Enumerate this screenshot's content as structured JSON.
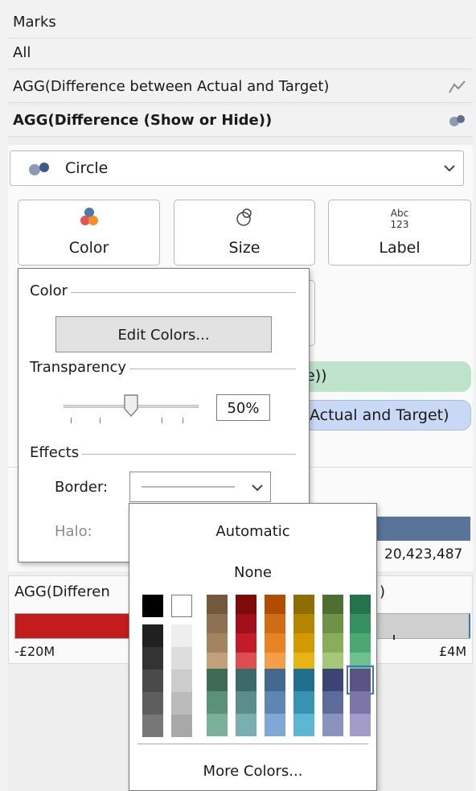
{
  "marks": {
    "header": "Marks",
    "rows": [
      {
        "label": "All"
      },
      {
        "label": "AGG(Difference between Actual and Target)"
      },
      {
        "label": "AGG(Difference (Show or Hide))"
      }
    ],
    "mark_type": "Circle",
    "cards": [
      "Color",
      "Size",
      "Label"
    ],
    "card_icons": [
      "color-dots-icon",
      "size-circles-icon",
      "abc-123-label-icon"
    ],
    "pills": [
      "e))",
      "Actual and Target)"
    ]
  },
  "color_popup": {
    "color_title": "Color",
    "edit_colors": "Edit Colors...",
    "transparency_title": "Transparency",
    "transparency_value": "50%",
    "transparency_level": 50,
    "effects_title": "Effects",
    "border_label": "Border:",
    "halo_label": "Halo:"
  },
  "filters": {
    "card1_value": "20,423,487",
    "card2_title": "AGG(Differen",
    "card2_title_tail": ")",
    "card2_left": "-£20M",
    "card2_right": "£4M"
  },
  "border_menu": {
    "automatic": "Automatic",
    "none": "None",
    "more_colors": "More Colors..."
  },
  "colors": {
    "pill_green": "#bde3cc",
    "pill_blue": "#c9d9f5",
    "bar_blue": "#5a7399",
    "bar_red": "#c21c1c",
    "selected_outline": "#3e73c2"
  }
}
